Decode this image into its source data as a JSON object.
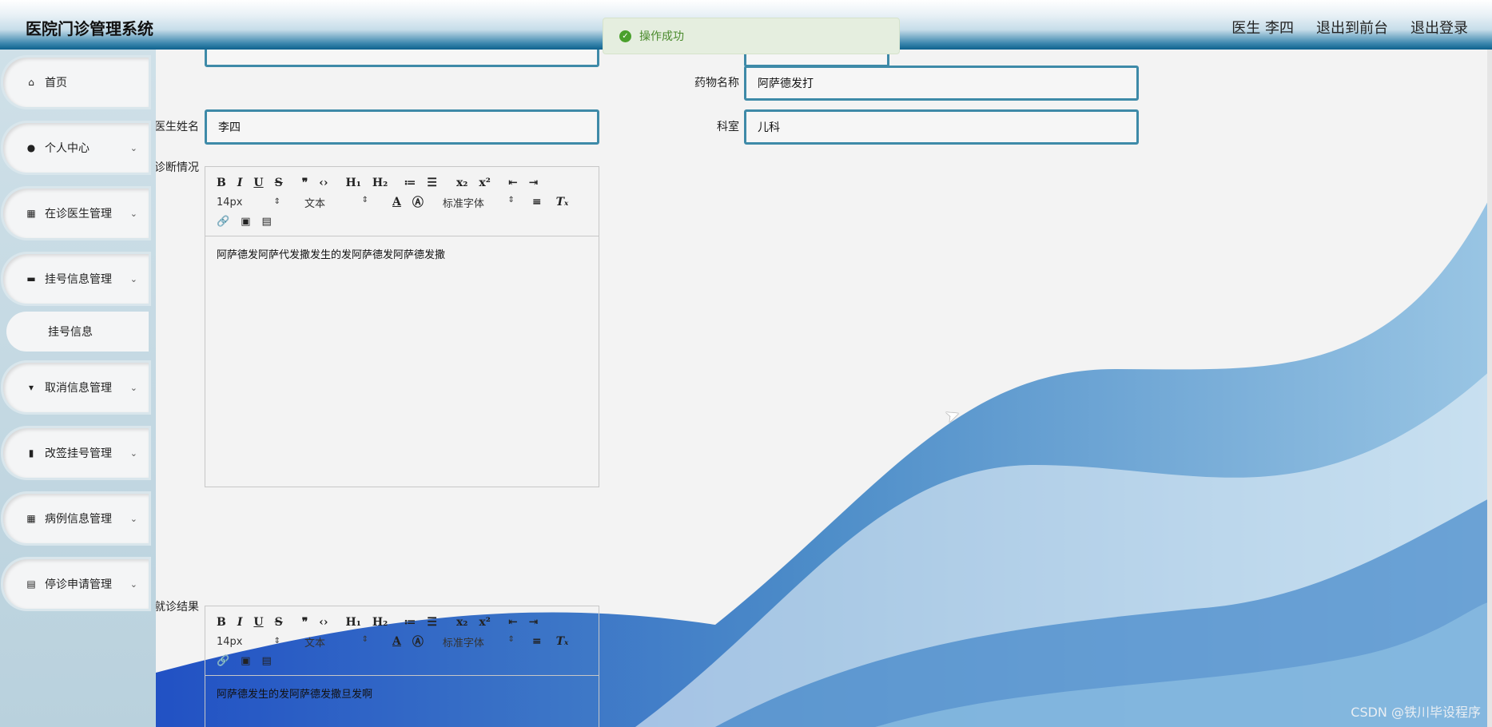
{
  "header": {
    "brand": "医院门诊管理系统",
    "user": "医生 李四",
    "to_front": "退出到前台",
    "logout": "退出登录"
  },
  "toast": {
    "message": "操作成功"
  },
  "sidebar": {
    "items": [
      {
        "label": "首页",
        "icon": "home-icon",
        "glyph": "⌂"
      },
      {
        "label": "个人中心",
        "icon": "user-icon",
        "glyph": "●"
      },
      {
        "label": "在诊医生管理",
        "icon": "grid-icon",
        "glyph": "▦"
      },
      {
        "label": "挂号信息管理",
        "icon": "briefcase-icon",
        "glyph": "▬"
      },
      {
        "label": "挂号信息",
        "icon": "",
        "glyph": ""
      },
      {
        "label": "取消信息管理",
        "icon": "stamp-icon",
        "glyph": "▾"
      },
      {
        "label": "改签挂号管理",
        "icon": "bar-chart-icon",
        "glyph": "▮"
      },
      {
        "label": "病例信息管理",
        "icon": "grid-icon",
        "glyph": "▦"
      },
      {
        "label": "停诊申请管理",
        "icon": "clipboard-icon",
        "glyph": "▤"
      }
    ]
  },
  "form": {
    "drug_label": "药物名称",
    "drug_value": "阿萨德发打",
    "doctor_label": "医生姓名",
    "doctor_value": "李四",
    "dept_label": "科室",
    "dept_value": "儿科",
    "diagnosis_label": "诊断情况",
    "diagnosis_text": "阿萨德发阿萨代发撒发生的发阿萨德发阿萨德发撒",
    "result_label": "就诊结果",
    "result_text": "阿萨德发生的发阿萨德发撒旦发啊"
  },
  "editor": {
    "font_size": "14px",
    "block_type": "文本",
    "font_family": "标准字体"
  },
  "watermark": "CSDN @铁川毕设程序"
}
